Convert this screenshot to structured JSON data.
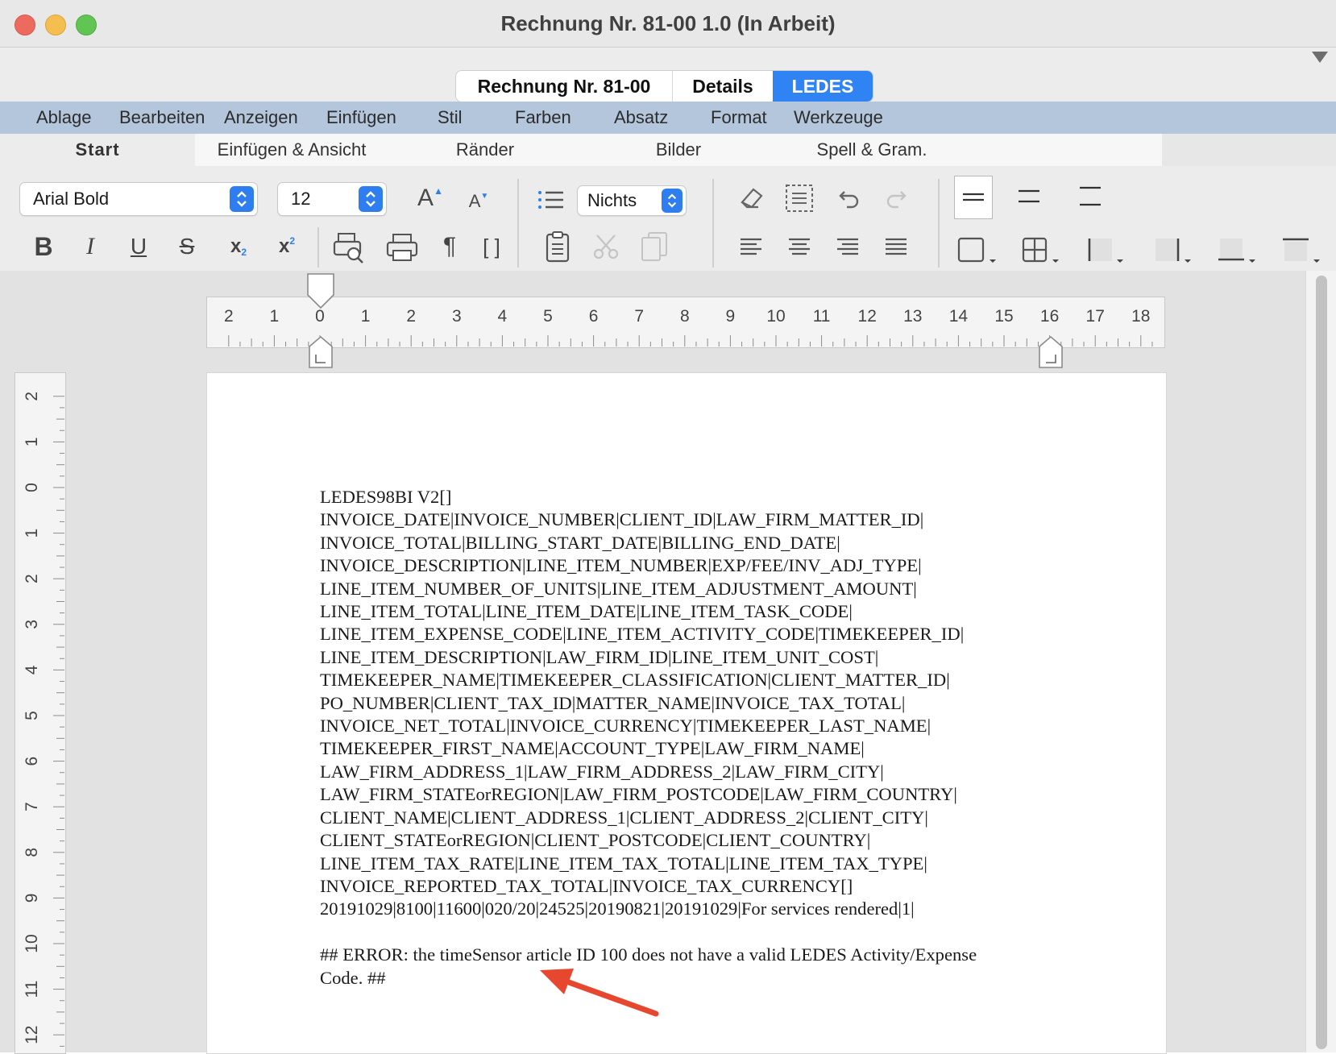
{
  "window": {
    "title": "Rechnung Nr. 81-00 1.0 (In Arbeit)",
    "traffic_light_colors": {
      "close": "#ed6a5e",
      "minimize": "#f5bf4f",
      "zoom": "#61c554"
    }
  },
  "tabs": [
    {
      "label": "Rechnung Nr. 81-00",
      "selected": false
    },
    {
      "label": "Details",
      "selected": false
    },
    {
      "label": "LEDES",
      "selected": true
    }
  ],
  "accent_color": "#2f83f2",
  "menu": [
    "Ablage",
    "Bearbeiten",
    "Anzeigen",
    "Einfügen",
    "Stil",
    "Farben",
    "Absatz",
    "Format",
    "Werkzeuge"
  ],
  "ribbon_tabs": [
    "Start",
    "Einfügen & Ansicht",
    "Ränder",
    "Bilder",
    "Spell & Gram.",
    ""
  ],
  "toolbar": {
    "font": "Arial Bold",
    "size": "12",
    "list_style": "Nichts",
    "icons": [
      "bold-icon",
      "italic-icon",
      "underline-icon",
      "strikethrough-icon",
      "subscript-icon",
      "superscript-icon",
      "grow-font-icon",
      "shrink-font-icon",
      "print-preview-icon",
      "print-icon",
      "pilcrow-icon",
      "brackets-icon",
      "list-icon",
      "paste-icon",
      "cut-icon",
      "copy-icon",
      "eraser-icon",
      "select-icon",
      "undo-icon",
      "redo-icon",
      "align-left-icon",
      "align-center-icon",
      "align-right-icon",
      "justify-icon"
    ],
    "labels": {
      "bold": "B",
      "italic": "I",
      "underline": "U",
      "strike": "S",
      "sub": "x",
      "sub_small": "2",
      "sup": "x",
      "sup_small": "2",
      "grow": "A",
      "shrink": "A",
      "pilcrow": "¶",
      "brackets": "[ ]"
    }
  },
  "ruler": {
    "horizontal": [
      "2",
      "1",
      "0",
      "1",
      "2",
      "3",
      "4",
      "5",
      "6",
      "7",
      "8",
      "9",
      "10",
      "11",
      "12",
      "13",
      "14",
      "15",
      "16",
      "17",
      "18"
    ],
    "vertical": [
      "2",
      "1",
      "0",
      "1",
      "2",
      "3",
      "4",
      "5",
      "6",
      "7",
      "8",
      "9",
      "10",
      "11",
      "12"
    ]
  },
  "document": {
    "lines": [
      "LEDES98BI V2[]",
      "INVOICE_DATE|INVOICE_NUMBER|CLIENT_ID|LAW_FIRM_MATTER_ID|",
      "INVOICE_TOTAL|BILLING_START_DATE|BILLING_END_DATE|",
      "INVOICE_DESCRIPTION|LINE_ITEM_NUMBER|EXP/FEE/INV_ADJ_TYPE|",
      "LINE_ITEM_NUMBER_OF_UNITS|LINE_ITEM_ADJUSTMENT_AMOUNT|",
      "LINE_ITEM_TOTAL|LINE_ITEM_DATE|LINE_ITEM_TASK_CODE|",
      "LINE_ITEM_EXPENSE_CODE|LINE_ITEM_ACTIVITY_CODE|TIMEKEEPER_ID|",
      "LINE_ITEM_DESCRIPTION|LAW_FIRM_ID|LINE_ITEM_UNIT_COST|",
      "TIMEKEEPER_NAME|TIMEKEEPER_CLASSIFICATION|CLIENT_MATTER_ID|",
      "PO_NUMBER|CLIENT_TAX_ID|MATTER_NAME|INVOICE_TAX_TOTAL|",
      "INVOICE_NET_TOTAL|INVOICE_CURRENCY|TIMEKEEPER_LAST_NAME|",
      "TIMEKEEPER_FIRST_NAME|ACCOUNT_TYPE|LAW_FIRM_NAME|",
      "LAW_FIRM_ADDRESS_1|LAW_FIRM_ADDRESS_2|LAW_FIRM_CITY|",
      "LAW_FIRM_STATEorREGION|LAW_FIRM_POSTCODE|LAW_FIRM_COUNTRY|",
      "CLIENT_NAME|CLIENT_ADDRESS_1|CLIENT_ADDRESS_2|CLIENT_CITY|",
      "CLIENT_STATEorREGION|CLIENT_POSTCODE|CLIENT_COUNTRY|",
      "LINE_ITEM_TAX_RATE|LINE_ITEM_TAX_TOTAL|LINE_ITEM_TAX_TYPE|",
      "INVOICE_REPORTED_TAX_TOTAL|INVOICE_TAX_CURRENCY[]",
      "20191029|8100|11600|020/20|24525|20190821|20191029|For services rendered|1|",
      "",
      "## ERROR: the timeSensor article ID 100 does not have a valid LEDES Activity/Expense",
      "Code. ##"
    ]
  },
  "annotation_arrow_color": "#e8472f"
}
